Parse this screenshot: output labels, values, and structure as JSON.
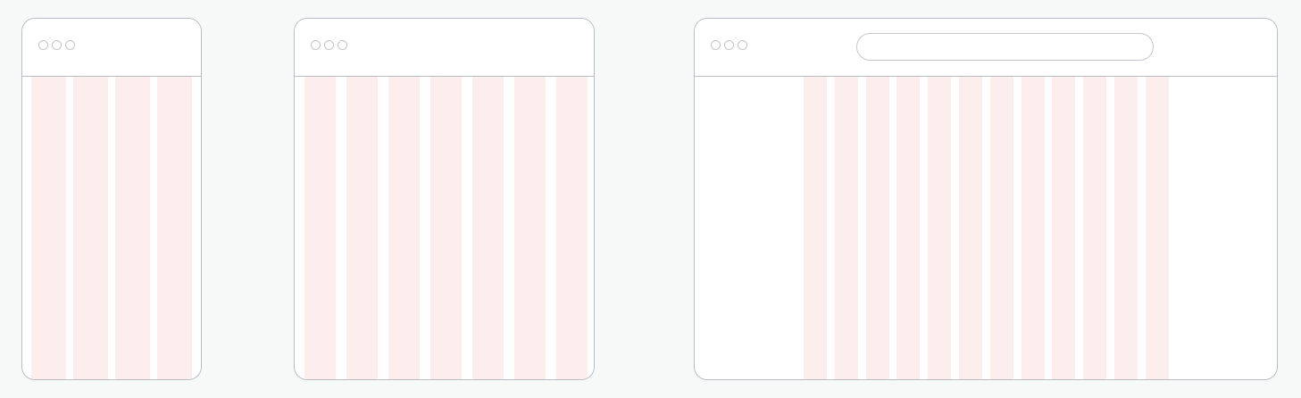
{
  "colors": {
    "page_background": "#f7f9f9",
    "frame_border": "#b9bcc3",
    "grid_column": "#fdeeee",
    "frame_fill": "#ffffff"
  },
  "icons": {
    "window_controls": [
      "window-control-dot-icon",
      "window-control-dot-icon",
      "window-control-dot-icon"
    ]
  },
  "devices": [
    {
      "name": "mobile",
      "columns": 4,
      "has_address_bar": false
    },
    {
      "name": "tablet",
      "columns": 7,
      "has_address_bar": false
    },
    {
      "name": "desktop",
      "columns": 12,
      "has_address_bar": true
    }
  ]
}
